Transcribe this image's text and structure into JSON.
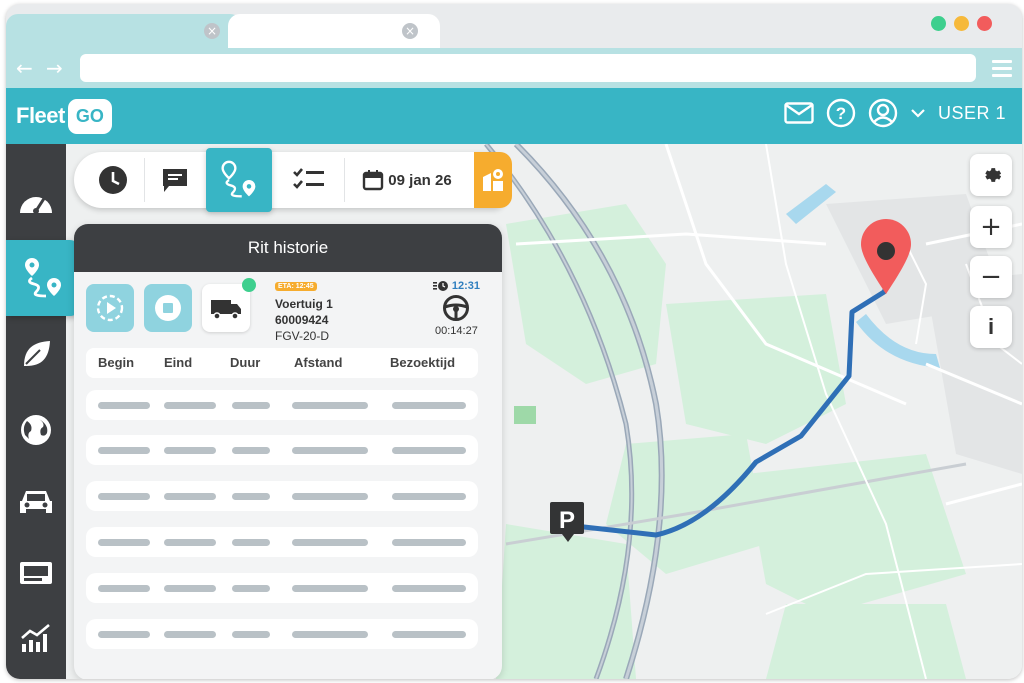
{
  "browser": {
    "dots": [
      "#3ecf8e",
      "#f6b93b",
      "#f25c5c"
    ],
    "tab_close": "×"
  },
  "app": {
    "logo_text": "Fleet",
    "logo_go": "GO",
    "user_label": "USER 1",
    "accent": "#38b5c5",
    "sidebar_color": "#3d3f42",
    "route_color": "#2f6fb6"
  },
  "header_icons": [
    "mail-icon",
    "help-icon",
    "user-avatar-icon",
    "chevron-down-icon"
  ],
  "sidebar": {
    "items": [
      "speedometer-icon",
      "route-icon",
      "leaf-icon",
      "globe-icon",
      "car-icon",
      "dashboard-card-icon",
      "chart-icon"
    ],
    "active": "route-icon"
  },
  "toolbar": {
    "date_label": "09 jan 26",
    "buttons": [
      "clock-icon",
      "message-icon",
      "route-icon",
      "checklist-icon",
      "calendar-icon",
      "map-layers-icon"
    ]
  },
  "panel": {
    "title": "Rit historie",
    "eta_label": "ETA: 12:45",
    "vehicle_name": "Voertuig 1",
    "vehicle_number": "60009424",
    "vehicle_plate": "FGV-20-D",
    "time_top": "12:31",
    "duration": "00:14:27",
    "columns": [
      "Begin",
      "Eind",
      "Duur",
      "Afstand",
      "Bezoektijd"
    ],
    "status_color": "#3ecf8e"
  },
  "map_controls": {
    "zoom_in": "+",
    "zoom_out": "−",
    "info": "i"
  },
  "map_markers": [
    "parking-marker",
    "destination-pin"
  ],
  "parking_label": "P"
}
